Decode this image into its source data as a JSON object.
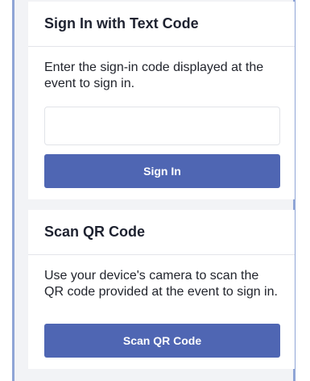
{
  "text_code": {
    "title": "Sign In with Text Code",
    "description": "Enter the sign-in code displayed at the event to sign in.",
    "input_value": "",
    "input_placeholder": "",
    "button_label": "Sign In"
  },
  "qr_code": {
    "title": "Scan QR Code",
    "description": "Use your device's camera to scan the QR code provided at the event to sign in.",
    "button_label": "Scan QR Code"
  },
  "colors": {
    "button": "#4f66b3",
    "frame_border": "#8fa5d6",
    "background": "#f2f3f6"
  }
}
